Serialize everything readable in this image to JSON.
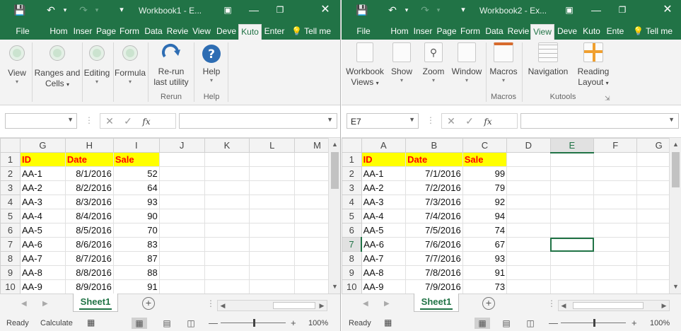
{
  "left": {
    "title": "Workbook1 - E...",
    "tabs": [
      "File",
      "Hom",
      "Inser",
      "Page",
      "Form",
      "Data",
      "Revie",
      "View",
      "Deve",
      "Kuto",
      "Enter",
      "Tell me"
    ],
    "active_tab": "Kuto",
    "ribbon": {
      "buttons": [
        {
          "label": "View",
          "caret": "▾"
        },
        {
          "label": "Ranges and",
          "label2": "Cells",
          "caret": "▾"
        },
        {
          "label": "Editing",
          "caret": "▾"
        },
        {
          "label": "Formula",
          "caret": "▾"
        },
        {
          "label": "Re-run",
          "label2": "last utility",
          "caret": ""
        },
        {
          "label": "Help",
          "caret": "▾"
        }
      ],
      "groups": [
        "Rerun",
        "Help"
      ]
    },
    "namebox": "",
    "fx": "fx",
    "columns": [
      "G",
      "H",
      "I",
      "J",
      "K",
      "L",
      "M"
    ],
    "rows": [
      {
        "n": "1",
        "cells": [
          "ID",
          "Date",
          "Sale",
          "",
          "",
          "",
          ""
        ]
      },
      {
        "n": "2",
        "cells": [
          "AA-1",
          "8/1/2016",
          "52",
          "",
          "",
          "",
          ""
        ]
      },
      {
        "n": "3",
        "cells": [
          "AA-2",
          "8/2/2016",
          "64",
          "",
          "",
          "",
          ""
        ]
      },
      {
        "n": "4",
        "cells": [
          "AA-3",
          "8/3/2016",
          "93",
          "",
          "",
          "",
          ""
        ]
      },
      {
        "n": "5",
        "cells": [
          "AA-4",
          "8/4/2016",
          "90",
          "",
          "",
          "",
          ""
        ]
      },
      {
        "n": "6",
        "cells": [
          "AA-5",
          "8/5/2016",
          "70",
          "",
          "",
          "",
          ""
        ]
      },
      {
        "n": "7",
        "cells": [
          "AA-6",
          "8/6/2016",
          "83",
          "",
          "",
          "",
          ""
        ]
      },
      {
        "n": "8",
        "cells": [
          "AA-7",
          "8/7/2016",
          "87",
          "",
          "",
          "",
          ""
        ]
      },
      {
        "n": "9",
        "cells": [
          "AA-8",
          "8/8/2016",
          "88",
          "",
          "",
          "",
          ""
        ]
      },
      {
        "n": "10",
        "cells": [
          "AA-9",
          "8/9/2016",
          "91",
          "",
          "",
          "",
          ""
        ]
      }
    ],
    "sheet_tab": "Sheet1",
    "status": [
      "Ready",
      "Calculate"
    ],
    "zoom": "100%"
  },
  "right": {
    "title": "Workbook2 - Ex...",
    "tabs": [
      "File",
      "Hom",
      "Inser",
      "Page",
      "Form",
      "Data",
      "Revie",
      "View",
      "Deve",
      "Kuto",
      "Ente",
      "Tell me"
    ],
    "active_tab": "View",
    "ribbon": {
      "buttons": [
        {
          "label": "Workbook",
          "label2": "Views",
          "caret": "▾"
        },
        {
          "label": "Show",
          "caret": "▾"
        },
        {
          "label": "Zoom",
          "caret": "▾"
        },
        {
          "label": "Window",
          "caret": "▾"
        },
        {
          "label": "Macros",
          "caret": "▾"
        },
        {
          "label": "Navigation",
          "caret": ""
        },
        {
          "label": "Reading",
          "label2": "Layout",
          "caret": "▾"
        }
      ],
      "groups": [
        "Macros",
        "Kutools"
      ]
    },
    "namebox": "E7",
    "fx": "fx",
    "columns": [
      "A",
      "B",
      "C",
      "D",
      "E",
      "F",
      "G"
    ],
    "rows": [
      {
        "n": "1",
        "cells": [
          "ID",
          "Date",
          "Sale",
          "",
          "",
          "",
          ""
        ]
      },
      {
        "n": "2",
        "cells": [
          "AA-1",
          "7/1/2016",
          "99",
          "",
          "",
          "",
          ""
        ]
      },
      {
        "n": "3",
        "cells": [
          "AA-2",
          "7/2/2016",
          "79",
          "",
          "",
          "",
          ""
        ]
      },
      {
        "n": "4",
        "cells": [
          "AA-3",
          "7/3/2016",
          "92",
          "",
          "",
          "",
          ""
        ]
      },
      {
        "n": "5",
        "cells": [
          "AA-4",
          "7/4/2016",
          "94",
          "",
          "",
          "",
          ""
        ]
      },
      {
        "n": "6",
        "cells": [
          "AA-5",
          "7/5/2016",
          "74",
          "",
          "",
          "",
          ""
        ]
      },
      {
        "n": "7",
        "cells": [
          "AA-6",
          "7/6/2016",
          "67",
          "",
          "",
          "",
          ""
        ]
      },
      {
        "n": "8",
        "cells": [
          "AA-7",
          "7/7/2016",
          "93",
          "",
          "",
          "",
          ""
        ]
      },
      {
        "n": "9",
        "cells": [
          "AA-8",
          "7/8/2016",
          "91",
          "",
          "",
          "",
          ""
        ]
      },
      {
        "n": "10",
        "cells": [
          "AA-9",
          "7/9/2016",
          "73",
          "",
          "",
          "",
          ""
        ]
      }
    ],
    "sheet_tab": "Sheet1",
    "status": [
      "Ready"
    ],
    "zoom": "100%"
  }
}
